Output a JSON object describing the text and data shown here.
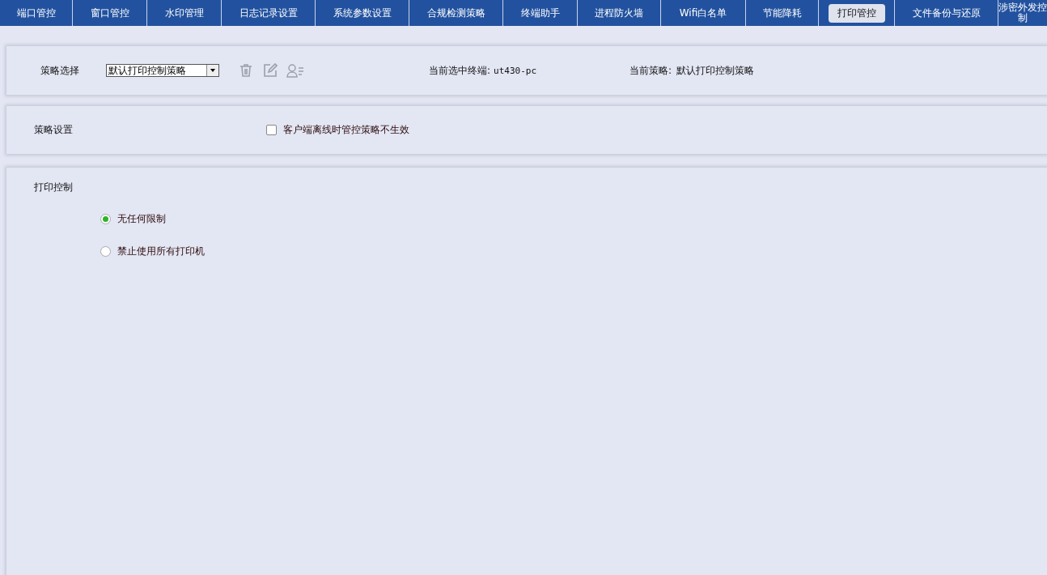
{
  "tabs": [
    {
      "label": "端口管控",
      "selected": false
    },
    {
      "label": "窗口管控",
      "selected": false
    },
    {
      "label": "水印管理",
      "selected": false
    },
    {
      "label": "日志记录设置",
      "selected": false
    },
    {
      "label": "系统参数设置",
      "selected": false
    },
    {
      "label": "合规检测策略",
      "selected": false
    },
    {
      "label": "终端助手",
      "selected": false
    },
    {
      "label": "进程防火墙",
      "selected": false
    },
    {
      "label": "Wifi白名单",
      "selected": false
    },
    {
      "label": "节能降耗",
      "selected": false
    },
    {
      "label": "打印管控",
      "selected": true
    },
    {
      "label": "文件备份与还原",
      "selected": false
    },
    {
      "label": "涉密外发控制",
      "selected": false
    }
  ],
  "policy_select": {
    "label": "策略选择",
    "value": "默认打印控制策略",
    "current_terminal": "当前选中终端:",
    "terminal_name": "ut430-pc",
    "current_policy": "当前策略:",
    "policy_name": "默认打印控制策略"
  },
  "policy_settings": {
    "label": "策略设置",
    "offline_option": {
      "label": "客户端离线时管控策略不生效",
      "checked": false
    }
  },
  "print_control": {
    "title": "打印控制",
    "options": [
      {
        "label": "无任何限制",
        "selected": true
      },
      {
        "label": "禁止使用所有打印机",
        "selected": false
      }
    ]
  }
}
